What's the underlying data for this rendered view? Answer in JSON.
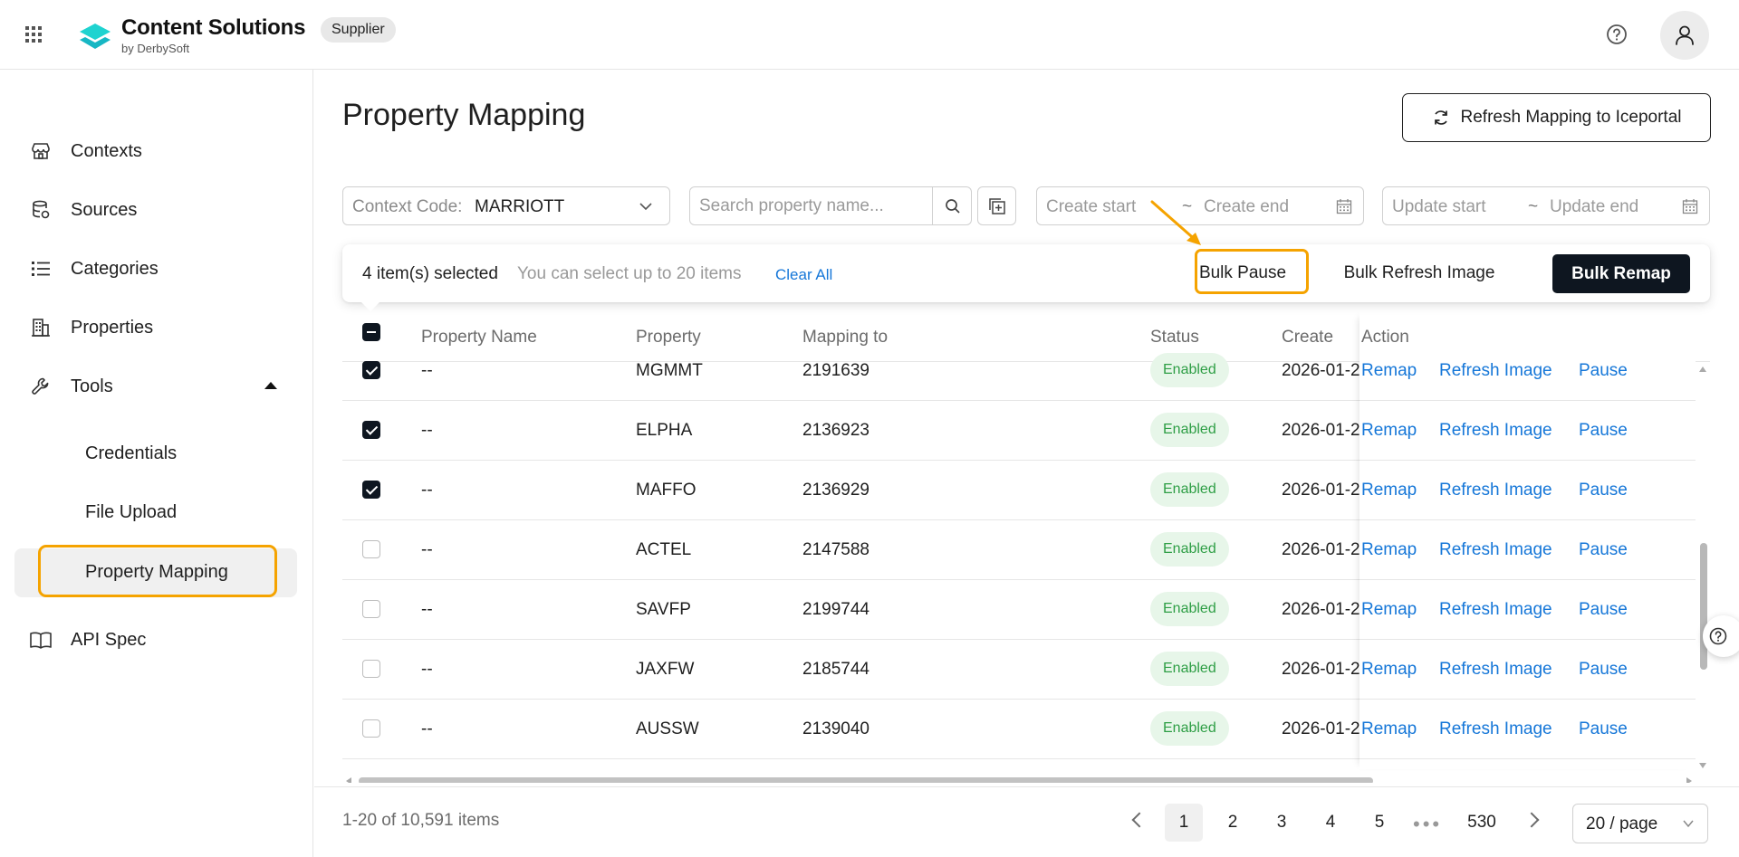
{
  "header": {
    "brand_name": "Content Solutions",
    "brand_sub": "by DerbySoft",
    "role_badge": "Supplier"
  },
  "sidebar": {
    "items": [
      {
        "label": "Contexts",
        "icon": "store-icon"
      },
      {
        "label": "Sources",
        "icon": "database-icon"
      },
      {
        "label": "Categories",
        "icon": "list-icon"
      },
      {
        "label": "Properties",
        "icon": "building-icon"
      },
      {
        "label": "Tools",
        "icon": "wrench-icon",
        "expanded": true
      },
      {
        "label": "API Spec",
        "icon": "book-icon"
      }
    ],
    "tools_sub": [
      {
        "label": "Credentials"
      },
      {
        "label": "File Upload"
      },
      {
        "label": "Property Mapping",
        "active": true
      }
    ]
  },
  "page": {
    "title": "Property Mapping",
    "refresh_button": "Refresh Mapping to Iceportal"
  },
  "filters": {
    "context_prefix": "Context Code:",
    "context_value": "MARRIOTT",
    "search_placeholder": "Search property name...",
    "create_start": "Create start",
    "create_end": "Create end",
    "update_start": "Update start",
    "update_end": "Update end",
    "tilde": "~"
  },
  "bulk": {
    "selected_text": "4 item(s) selected",
    "limit_text": "You can select up to 20 items",
    "clear_all": "Clear All",
    "bulk_pause": "Bulk Pause",
    "bulk_refresh_image": "Bulk Refresh Image",
    "bulk_remap": "Bulk Remap"
  },
  "table": {
    "columns": {
      "property_name": "Property Name",
      "property": "Property",
      "mapping_to": "Mapping to",
      "status": "Status",
      "create_time": "Create Time",
      "action": "Action"
    },
    "actions": {
      "remap": "Remap",
      "refresh_image": "Refresh Image",
      "pause": "Pause"
    },
    "rows": [
      {
        "checked": true,
        "property_name": "--",
        "property": "MGMMT",
        "mapping_to": "2191639",
        "status": "Enabled",
        "create_time": "2026-01-2"
      },
      {
        "checked": true,
        "property_name": "--",
        "property": "ELPHA",
        "mapping_to": "2136923",
        "status": "Enabled",
        "create_time": "2026-01-2"
      },
      {
        "checked": true,
        "property_name": "--",
        "property": "MAFFO",
        "mapping_to": "2136929",
        "status": "Enabled",
        "create_time": "2026-01-2"
      },
      {
        "checked": false,
        "property_name": "--",
        "property": "ACTEL",
        "mapping_to": "2147588",
        "status": "Enabled",
        "create_time": "2026-01-2"
      },
      {
        "checked": false,
        "property_name": "--",
        "property": "SAVFP",
        "mapping_to": "2199744",
        "status": "Enabled",
        "create_time": "2026-01-2"
      },
      {
        "checked": false,
        "property_name": "--",
        "property": "JAXFW",
        "mapping_to": "2185744",
        "status": "Enabled",
        "create_time": "2026-01-2"
      },
      {
        "checked": false,
        "property_name": "--",
        "property": "AUSSW",
        "mapping_to": "2139040",
        "status": "Enabled",
        "create_time": "2026-01-2"
      }
    ]
  },
  "pagination": {
    "total": "1-20 of 10,591 items",
    "pages": [
      "1",
      "2",
      "3",
      "4",
      "5"
    ],
    "dots": "•••",
    "last_page": "530",
    "current_page": "1",
    "page_size": "20 / page"
  },
  "colors": {
    "accent_blue": "#1677d8",
    "brand_cyan": "#1fd3d0",
    "annotation_orange": "#f5a300",
    "primary_dark": "#0e1620",
    "status_green": "#2e9e45"
  }
}
